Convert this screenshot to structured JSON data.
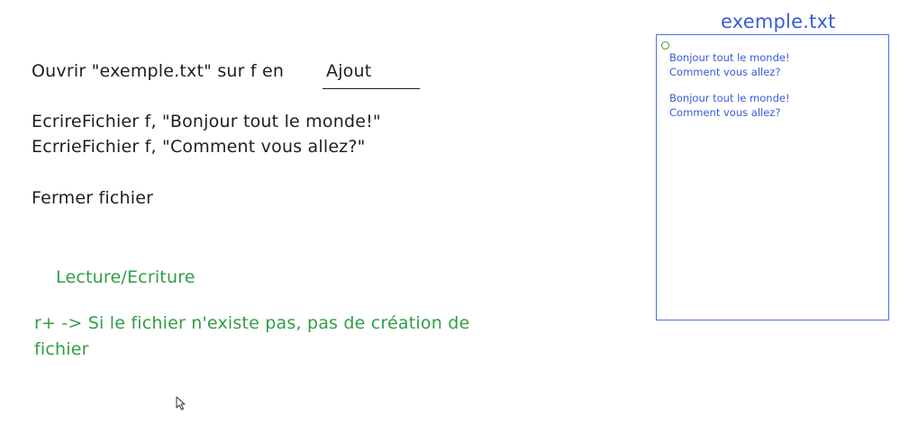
{
  "code": {
    "line_open": "Ouvrir \"exemple.txt\" sur f en",
    "line_open_mode": "Ajout",
    "line_write1": "EcrireFichier f, \"Bonjour tout le monde!\"",
    "line_write2": "EcrrieFichier f, \"Comment vous allez?\"",
    "line_close": "Fermer fichier"
  },
  "note": {
    "heading": "Lecture/Ecriture",
    "line1": "r+ -> Si le fichier n'existe pas, pas de création de",
    "line2": "fichier"
  },
  "file": {
    "title": "exemple.txt",
    "lines": [
      "Bonjour tout le monde!",
      "Comment vous allez?",
      "Bonjour tout le monde!",
      "Comment vous allez?"
    ]
  },
  "colors": {
    "text": "#1e1e1e",
    "green": "#2f9e44",
    "blue": "#3b5bdb",
    "box_border": "#4c6ef5"
  },
  "icons": {
    "cursor": "mouse-pointer-icon",
    "dot": "circle-icon"
  }
}
